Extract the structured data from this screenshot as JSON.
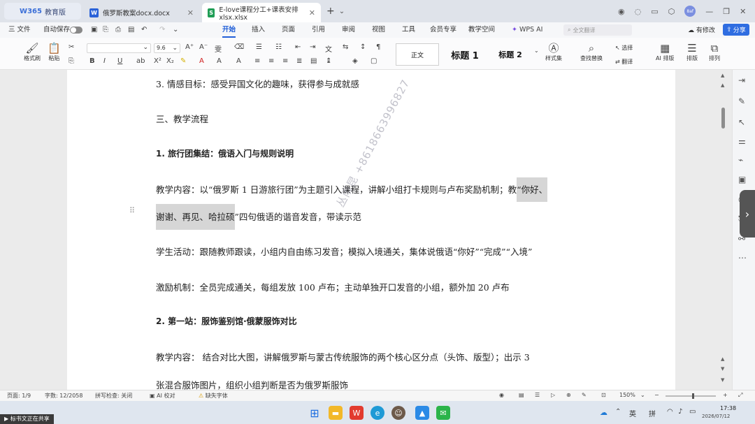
{
  "tabs": {
    "brand_logo": "W365",
    "brand_label": "教育版",
    "doc_tab": {
      "icon": "W",
      "title": "俄罗斯教案docx.docx"
    },
    "sheet_tab": {
      "icon": "S",
      "title": "E-love课程分工+课表安排xlsx.xlsx"
    },
    "new_tab": "+",
    "tab_dropdown": "⌄"
  },
  "window": {
    "avatar": "8af",
    "minimize": "—",
    "restore": "❐",
    "close": "✕"
  },
  "menubar": {
    "file": "三 文件",
    "autosave": "自动保存",
    "items": [
      "开始",
      "插入",
      "页面",
      "引用",
      "审阅",
      "视图",
      "工具",
      "会员专享",
      "教学空间"
    ],
    "wps_ai": "WPS AI",
    "search_placeholder": "全文翻译",
    "changes": "有修改",
    "share": "分享"
  },
  "ribbon": {
    "format_painter": "格式刷",
    "paste": "粘贴",
    "font_size": "9.6",
    "style_normal": "正文",
    "style_h1": "标题 1",
    "style_h2": "标题 2",
    "style_set": "样式集",
    "find_replace": "查找替换",
    "select": "选择",
    "translate": "翻译",
    "ai_layout": "AI 排版",
    "layout": "排版",
    "arrange": "排列"
  },
  "document": {
    "lines": [
      "3. 情感目标：感受异国文化的趣味，获得参与成就感",
      "三、教学流程",
      "1. 旅行团集结：俄语入门与规则说明",
      "教学内容：以“俄罗斯 1 日游旅行团”为主题引入课程，讲解小组打卡规则与卢布奖励机制；教",
      "“你好、",
      "谢谢、再见、哈拉硕",
      "”四句俄语的谐音发音，带读示范",
      "学生活动：跟随教师跟读，小组内自由练习发音；模拟入境通关，集体说俄语“你好”“完成”“入境”",
      "激励机制：全员完成通关，每组发放 100 卢布；主动单独开口发音的小组，额外加 20 卢布",
      "2. 第一站：服饰鉴别馆·俄蒙服饰对比",
      "教学内容：  结合对比大图，讲解俄罗斯与蒙古传统服饰的两个核心区分点（头饰、版型）；出示 3",
      "张混合服饰图片，组织小组判断是否为俄罗斯服饰"
    ],
    "watermark": "丛雨昆 +8618663996827"
  },
  "statusbar": {
    "page": "页面: 1/9",
    "words": "字数: 12/2058",
    "spell": "拼写检查: 关闭",
    "ai_check": "AI 校对",
    "missing_font": "缺失字体",
    "zoom": "150%"
  },
  "taskbar": {
    "caption": "标书文正在共享",
    "ime_lang": "英",
    "ime_mode": "拼",
    "time": "17:38",
    "date": "2026/07/12"
  }
}
